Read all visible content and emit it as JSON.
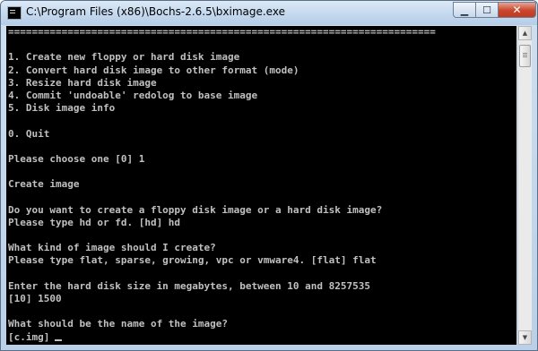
{
  "window": {
    "title": "C:\\Program Files (x86)\\Bochs-2.6.5\\bximage.exe",
    "minimize_glyph": "▁",
    "maximize_glyph": "☐",
    "close_glyph": "✕"
  },
  "console": {
    "lines": [
      "========================================================================",
      "",
      "1. Create new floppy or hard disk image",
      "2. Convert hard disk image to other format (mode)",
      "3. Resize hard disk image",
      "4. Commit 'undoable' redolog to base image",
      "5. Disk image info",
      "",
      "0. Quit",
      "",
      "Please choose one [0] 1",
      "",
      "Create image",
      "",
      "Do you want to create a floppy disk image or a hard disk image?",
      "Please type hd or fd. [hd] hd",
      "",
      "What kind of image should I create?",
      "Please type flat, sparse, growing, vpc or vmware4. [flat] flat",
      "",
      "Enter the hard disk size in megabytes, between 10 and 8257535",
      "[10] 1500",
      "",
      "What should be the name of the image?",
      "[c.img]"
    ]
  },
  "scrollbar": {
    "up_glyph": "▲",
    "down_glyph": "▼"
  }
}
